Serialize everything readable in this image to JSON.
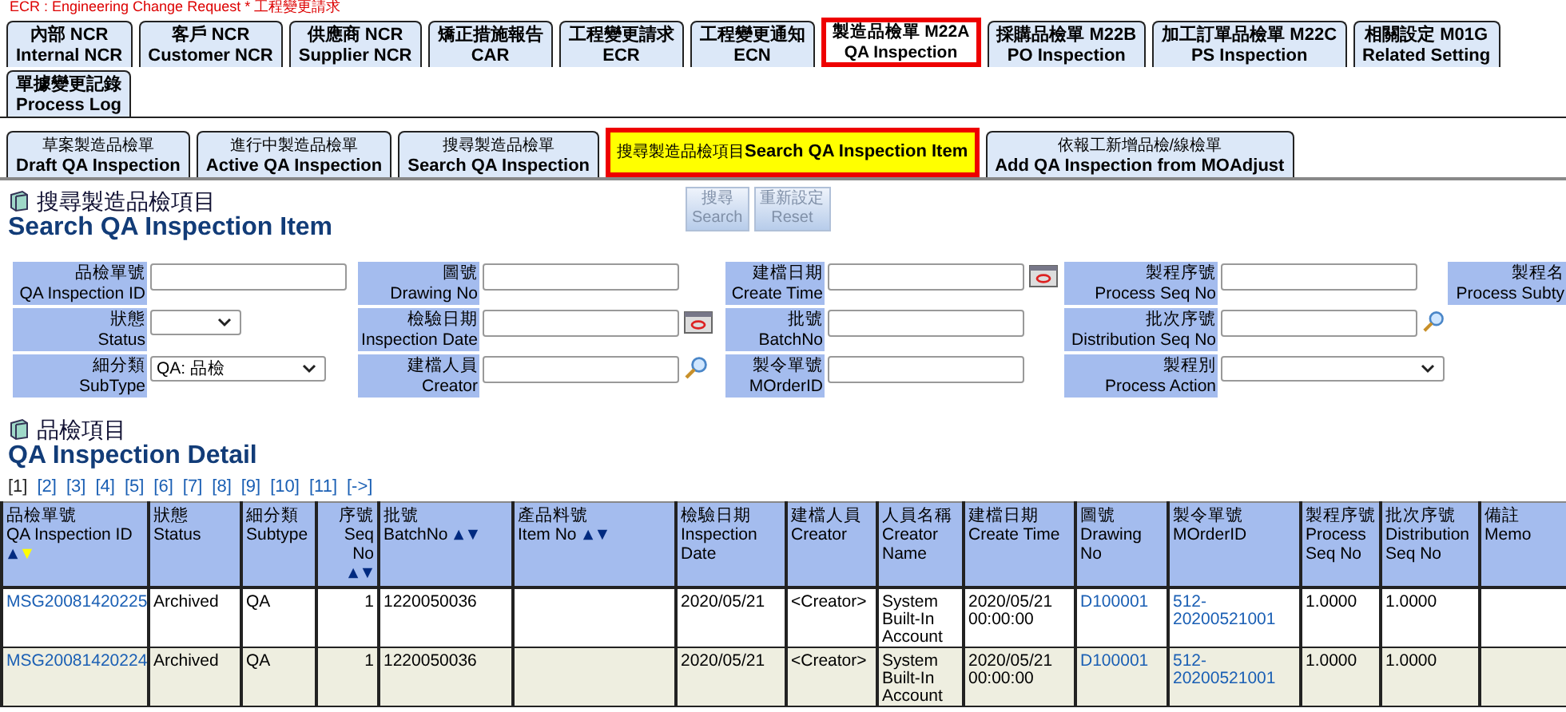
{
  "notice": "ECR : Engineering Change Request * 工程變更請求",
  "tabs": [
    {
      "zh": "內部 NCR",
      "en": "Internal NCR",
      "selected": false,
      "highlighted": false
    },
    {
      "zh": "客戶 NCR",
      "en": "Customer NCR",
      "selected": false,
      "highlighted": false
    },
    {
      "zh": "供應商 NCR",
      "en": "Supplier NCR",
      "selected": false,
      "highlighted": false
    },
    {
      "zh": "矯正措施報告",
      "en": "CAR",
      "selected": false,
      "highlighted": false
    },
    {
      "zh": "工程變更請求",
      "en": "ECR",
      "selected": false,
      "highlighted": false
    },
    {
      "zh": "工程變更通知",
      "en": "ECN",
      "selected": false,
      "highlighted": false
    },
    {
      "zh": "製造品檢單 M22A",
      "en": "QA Inspection",
      "selected": true,
      "highlighted": true
    },
    {
      "zh": "採購品檢單 M22B",
      "en": "PO Inspection",
      "selected": false,
      "highlighted": false
    },
    {
      "zh": "加工訂單品檢單 M22C",
      "en": "PS Inspection",
      "selected": false,
      "highlighted": false
    },
    {
      "zh": "相關設定 M01G",
      "en": "Related Setting",
      "selected": false,
      "highlighted": false
    },
    {
      "zh": "單據變更記錄",
      "en": "Process Log",
      "selected": false,
      "highlighted": false
    }
  ],
  "subtabs": [
    {
      "zh": "草案製造品檢單",
      "en": "Draft QA Inspection",
      "selected": false,
      "highlighted": false
    },
    {
      "zh": "進行中製造品檢單",
      "en": "Active QA Inspection",
      "selected": false,
      "highlighted": false
    },
    {
      "zh": "搜尋製造品檢單",
      "en": "Search QA Inspection",
      "selected": false,
      "highlighted": false
    },
    {
      "zh": "搜尋製造品檢項目",
      "en": "Search QA Inspection Item",
      "selected": true,
      "highlighted": true
    },
    {
      "zh": "依報工新增品檢/線檢單",
      "en": "Add QA Inspection from MOAdjust",
      "selected": false,
      "highlighted": false
    }
  ],
  "search_section": {
    "title_zh": "搜尋製造品檢項目",
    "title_en": "Search QA Inspection Item"
  },
  "actions": [
    {
      "zh": "搜尋",
      "en": "Search",
      "disabled": true
    },
    {
      "zh": "重新設定",
      "en": "Reset",
      "disabled": true
    }
  ],
  "form_rows": [
    [
      {
        "zh": "品檢單號",
        "en": "QA Inspection ID",
        "kind": "text"
      },
      {
        "zh": "圖號",
        "en": "Drawing No",
        "kind": "text"
      },
      {
        "zh": "建檔日期",
        "en": "Create Time",
        "kind": "date"
      },
      {
        "zh": "製程序號",
        "en": "Process Seq No",
        "kind": "text"
      },
      {
        "zh": "製程名",
        "en": "Process Subty",
        "kind": "label"
      }
    ],
    [
      {
        "zh": "狀態",
        "en": "Status",
        "kind": "select_small"
      },
      {
        "zh": "檢驗日期",
        "en": "Inspection Date",
        "kind": "date"
      },
      {
        "zh": "批號",
        "en": "BatchNo",
        "kind": "text"
      },
      {
        "zh": "批次序號",
        "en": "Distribution Seq No",
        "kind": "lookup"
      }
    ],
    [
      {
        "zh": "細分類",
        "en": "SubType",
        "kind": "select",
        "value": "QA: 品檢"
      },
      {
        "zh": "建檔人員",
        "en": "Creator",
        "kind": "lookup"
      },
      {
        "zh": "製令單號",
        "en": "MOrderID",
        "kind": "text"
      },
      {
        "zh": "製程別",
        "en": "Process Action",
        "kind": "select_wide"
      }
    ]
  ],
  "detail_section": {
    "title_zh": "品檢項目",
    "title_en": "QA Inspection Detail"
  },
  "pages": [
    {
      "label": "[1]",
      "selected": true
    },
    {
      "label": "[2]",
      "selected": false
    },
    {
      "label": "[3]",
      "selected": false
    },
    {
      "label": "[4]",
      "selected": false
    },
    {
      "label": "[5]",
      "selected": false
    },
    {
      "label": "[6]",
      "selected": false
    },
    {
      "label": "[7]",
      "selected": false
    },
    {
      "label": "[8]",
      "selected": false
    },
    {
      "label": "[9]",
      "selected": false
    },
    {
      "label": "[10]",
      "selected": false
    },
    {
      "label": "[11]",
      "selected": false
    },
    {
      "label": "[->]",
      "selected": false
    }
  ],
  "table": {
    "columns": [
      {
        "zh": "品檢單號",
        "en": "QA Inspection ID",
        "kind": "link",
        "sortable": true,
        "sort_descending": true
      },
      {
        "zh": "狀態",
        "en": "Status",
        "kind": "text"
      },
      {
        "zh": "細分類",
        "en": "Subtype",
        "kind": "text"
      },
      {
        "zh": "序號",
        "en": "Seq No",
        "kind": "number",
        "sortable": true,
        "sort_descending": false
      },
      {
        "zh": "批號",
        "en": "BatchNo",
        "kind": "text",
        "sortable": true,
        "sort_descending": false
      },
      {
        "zh": "產品料號",
        "en": "Item No",
        "kind": "text",
        "sortable": true,
        "sort_descending": false
      },
      {
        "zh": "檢驗日期",
        "en": "Inspection Date",
        "kind": "text"
      },
      {
        "zh": "建檔人員",
        "en": "Creator",
        "kind": "text"
      },
      {
        "zh": "人員名稱",
        "en": "Creator Name",
        "kind": "text"
      },
      {
        "zh": "建檔日期",
        "en": "Create Time",
        "kind": "text"
      },
      {
        "zh": "圖號",
        "en": "Drawing No",
        "kind": "link"
      },
      {
        "zh": "製令單號",
        "en": "MOrderID",
        "kind": "link"
      },
      {
        "zh": "製程序號",
        "en": "Process Seq No",
        "kind": "text"
      },
      {
        "zh": "批次序號",
        "en": "Distribution Seq No",
        "kind": "text"
      },
      {
        "zh": "備註",
        "en": "Memo",
        "kind": "text"
      }
    ],
    "rows": [
      [
        "MSG20081420225",
        "Archived",
        "QA",
        "1",
        "1220050036",
        "",
        "2020/05/21",
        "<Creator>",
        "System Built-In Account",
        "2020/05/21 00:00:00",
        "D100001",
        "512-20200521001",
        "1.0000",
        "1.0000",
        ""
      ],
      [
        "MSG20081420224",
        "Archived",
        "QA",
        "1",
        "1220050036",
        "",
        "2020/05/21",
        "<Creator>",
        "System Built-In Account",
        "2020/05/21 00:00:00",
        "D100001",
        "512-20200521001",
        "1.0000",
        "1.0000",
        ""
      ]
    ]
  }
}
